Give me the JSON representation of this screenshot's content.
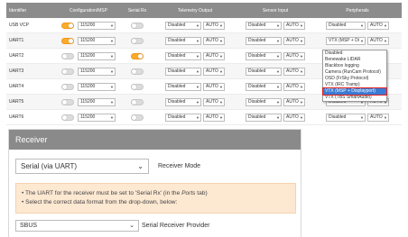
{
  "ports_table": {
    "headers": [
      "Identifier",
      "Configuration/MSP",
      "Serial Rx",
      "Telemetry Output",
      "Sensor Input",
      "Peripherals"
    ],
    "rows": [
      {
        "id": "USB VCP",
        "msp_on": true,
        "baud": "115200",
        "rx_on": false,
        "tel": "Disabled",
        "tel_baud": "AUTO",
        "sen": "Disabled",
        "sen_baud": "AUTO",
        "per": "Disabled",
        "per_baud": "AUTO"
      },
      {
        "id": "UART1",
        "msp_on": true,
        "baud": "115200",
        "rx_on": false,
        "tel": "Disabled",
        "tel_baud": "AUTO",
        "sen": "Disabled",
        "sen_baud": "AUTO",
        "per": "VTX (MSP + Di",
        "per_baud": "AUTO"
      },
      {
        "id": "UART2",
        "msp_on": false,
        "baud": "115200",
        "rx_on": true,
        "tel": "Disabled",
        "tel_baud": "AUTO",
        "sen": "Disabled",
        "sen_baud": "AUTO",
        "per": "",
        "per_baud": ""
      },
      {
        "id": "UART3",
        "msp_on": false,
        "baud": "115200",
        "rx_on": false,
        "tel": "Disabled",
        "tel_baud": "AUTO",
        "sen": "Disabled",
        "sen_baud": "AUTO",
        "per": "",
        "per_baud": ""
      },
      {
        "id": "UART4",
        "msp_on": false,
        "baud": "115200",
        "rx_on": false,
        "tel": "Disabled",
        "tel_baud": "AUTO",
        "sen": "Disabled",
        "sen_baud": "AUTO",
        "per": "",
        "per_baud": ""
      },
      {
        "id": "UART5",
        "msp_on": false,
        "baud": "115200",
        "rx_on": false,
        "tel": "Disabled",
        "tel_baud": "AUTO",
        "sen": "Disabled",
        "sen_baud": "AUTO",
        "per": "Disabled",
        "per_baud": "AUTO"
      },
      {
        "id": "UART6",
        "msp_on": false,
        "baud": "115200",
        "rx_on": false,
        "tel": "Disabled",
        "tel_baud": "AUTO",
        "sen": "Disabled",
        "sen_baud": "AUTO",
        "per": "Disabled",
        "per_baud": "AUTO"
      }
    ]
  },
  "peripheral_dropdown": {
    "options": [
      "Disabled",
      "Benewake LIDAR",
      "Blackbox logging",
      "Camera (RunCam Protocol)",
      "OSD (FrSky Protocol)",
      "VTX (IRC Tramp)",
      "VTX (MSP + Displayport)",
      "VTX (TBS SmartAudio)"
    ],
    "highlighted": "VTX (MSP + Displayport)"
  },
  "receiver": {
    "title": "Receiver",
    "mode_value": "Serial (via UART)",
    "mode_label": "Receiver Mode",
    "note_line1_prefix": "• The UART for the receiver must be set to 'Serial Rx' (in the ",
    "note_line1_em": "Ports",
    "note_line1_suffix": " tab)",
    "note_line2": "• Select the correct data format from the drop-down, below:",
    "provider_value": "SBUS",
    "provider_label": "Serial Receiver Provider"
  },
  "colors": {
    "header_bg": "#8c8c8c",
    "toggle_on": "#ffaa2a",
    "note_bg": "#fde8d2",
    "highlight": "#3a7bd5"
  }
}
